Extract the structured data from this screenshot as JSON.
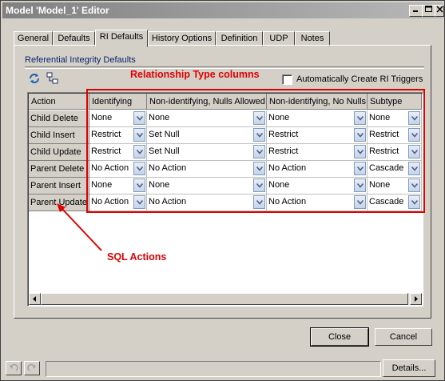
{
  "window": {
    "title": "Model 'Model_1' Editor",
    "controls": [
      "minimize",
      "maximize",
      "close"
    ]
  },
  "tabs": [
    {
      "label": "General"
    },
    {
      "label": "Defaults"
    },
    {
      "label": "RI Defaults",
      "active": true
    },
    {
      "label": "History Options"
    },
    {
      "label": "Definition"
    },
    {
      "label": "UDP"
    },
    {
      "label": "Notes"
    }
  ],
  "group": {
    "label": "Referential Integrity Defaults",
    "auto_create_label": "Automatically Create RI Triggers",
    "auto_create_checked": false
  },
  "annotations": {
    "relationship_columns": "Relationship Type columns",
    "sql_actions": "SQL Actions"
  },
  "grid": {
    "action_header": "Action",
    "columns": [
      {
        "label": "Identifying"
      },
      {
        "label": "Non-identifying, Nulls Allowed"
      },
      {
        "label": "Non-identifying, No Nulls"
      },
      {
        "label": "Subtype"
      }
    ],
    "rows": [
      {
        "action": "Child Delete",
        "values": [
          "None",
          "None",
          "None",
          "None"
        ]
      },
      {
        "action": "Child Insert",
        "values": [
          "Restrict",
          "Set Null",
          "Restrict",
          "Restrict"
        ]
      },
      {
        "action": "Child Update",
        "values": [
          "Restrict",
          "Set Null",
          "Restrict",
          "Restrict"
        ]
      },
      {
        "action": "Parent Delete",
        "values": [
          "No Action",
          "No Action",
          "No Action",
          "Cascade"
        ]
      },
      {
        "action": "Parent Insert",
        "values": [
          "None",
          "None",
          "None",
          "None"
        ]
      },
      {
        "action": "Parent Update",
        "values": [
          "No Action",
          "No Action",
          "No Action",
          "Cascade"
        ]
      }
    ]
  },
  "buttons": {
    "close": "Close",
    "cancel": "Cancel",
    "details": "Details..."
  },
  "colors": {
    "annotation": "#e00000",
    "group_label": "#0a246a"
  }
}
